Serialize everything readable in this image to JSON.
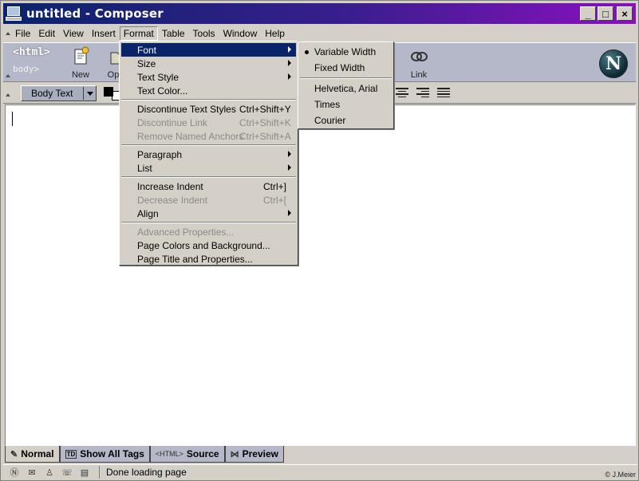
{
  "window": {
    "title": "untitled - Composer",
    "minimize_glyph": "_",
    "maximize_glyph": "□",
    "close_glyph": "×"
  },
  "menubar": {
    "items": [
      "File",
      "Edit",
      "View",
      "Insert",
      "Format",
      "Table",
      "Tools",
      "Window",
      "Help"
    ],
    "active": "Format"
  },
  "toolbar": {
    "html_tag": "<html>",
    "body_tag": "body>",
    "new_label": "New",
    "open_label": "Op",
    "link_label": "Link"
  },
  "formatbar": {
    "paragraph_style": "Body Text"
  },
  "format_menu": {
    "items": [
      {
        "label": "Font",
        "shortcut": "",
        "disabled": false,
        "submenu": true,
        "highlight": true
      },
      {
        "label": "Size",
        "shortcut": "",
        "disabled": false,
        "submenu": true
      },
      {
        "label": "Text Style",
        "shortcut": "",
        "disabled": false,
        "submenu": true
      },
      {
        "label": "Text Color...",
        "shortcut": "",
        "disabled": false
      },
      {
        "label": "Discontinue Text Styles",
        "shortcut": "Ctrl+Shift+Y",
        "disabled": false
      },
      {
        "label": "Discontinue Link",
        "shortcut": "Ctrl+Shift+K",
        "disabled": true
      },
      {
        "label": "Remove Named Anchors",
        "shortcut": "Ctrl+Shift+A",
        "disabled": true
      },
      {
        "label": "Paragraph",
        "shortcut": "",
        "disabled": false,
        "submenu": true
      },
      {
        "label": "List",
        "shortcut": "",
        "disabled": false,
        "submenu": true
      },
      {
        "label": "Increase Indent",
        "shortcut": "Ctrl+]",
        "disabled": false
      },
      {
        "label": "Decrease Indent",
        "shortcut": "Ctrl+[",
        "disabled": true
      },
      {
        "label": "Align",
        "shortcut": "",
        "disabled": false,
        "submenu": true
      },
      {
        "label": "Advanced Properties...",
        "shortcut": "",
        "disabled": true
      },
      {
        "label": "Page Colors and Background...",
        "shortcut": "",
        "disabled": false
      },
      {
        "label": "Page Title and Properties...",
        "shortcut": "",
        "disabled": false
      }
    ]
  },
  "font_submenu": {
    "items": [
      {
        "label": "Variable Width",
        "checked": true
      },
      {
        "label": "Fixed Width",
        "checked": false
      },
      {
        "label": "Helvetica, Arial",
        "checked": false
      },
      {
        "label": "Times",
        "checked": false
      },
      {
        "label": "Courier",
        "checked": false
      }
    ]
  },
  "tabs": [
    {
      "label": "Normal",
      "active": true
    },
    {
      "label": "Show All Tags",
      "active": false
    },
    {
      "label": "Source",
      "active": false
    },
    {
      "label": "Preview",
      "active": false
    }
  ],
  "tab_badges": {
    "td": "TD",
    "html": "<HTML>"
  },
  "status": {
    "text": "Done loading page",
    "copyright": "© J.Meier"
  }
}
